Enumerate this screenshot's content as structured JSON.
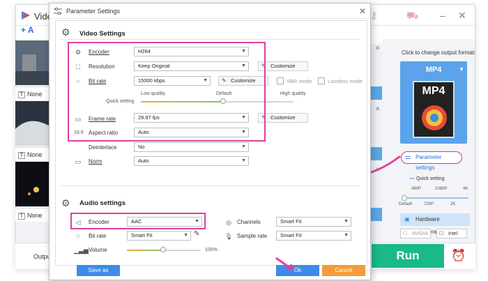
{
  "background_app": {
    "title": "Video",
    "add_label": "+ A",
    "thumb_rows": [
      {
        "label": "None"
      },
      {
        "label": "None"
      },
      {
        "label": "None"
      }
    ],
    "output_label": "Output f",
    "right_panel": {
      "format_title": "Click to change output format:",
      "format_name": "MP4",
      "format_box_text": "MP4",
      "parameter_button": "Parameter settings",
      "quick_setting": "Quick setting",
      "quality_top": [
        "480P",
        "1080P",
        "4K"
      ],
      "quality_bottom": [
        "Default",
        "720P",
        "2K"
      ],
      "hardware_button": "Hardware acceleration",
      "chips": [
        "NVIDIA",
        "Intel"
      ]
    },
    "run_label": "Run"
  },
  "dialog": {
    "title": "Parameter Settings",
    "video_section": {
      "title": "Video Settings",
      "encoder": {
        "label": "Encoder",
        "value": "H264"
      },
      "resolution": {
        "label": "Resolution",
        "value": "Keep Original",
        "custom_label": "Customize"
      },
      "bitrate": {
        "label": "Bit rate",
        "value": "15000 kbps",
        "custom_label": "Customize",
        "vbr_label": "VBR mode",
        "lossless_label": "Lossless mode"
      },
      "quality": {
        "quick_label": "Quick setting",
        "low": "Low quality",
        "default": "Default",
        "high": "High quality"
      },
      "framerate": {
        "label": "Frame rate",
        "value": "29.97 fps",
        "custom_label": "Customize"
      },
      "aspect": {
        "label": "Aspect ratio",
        "value": "Auto"
      },
      "deinterlace": {
        "label": "Deinterlace",
        "value": "No"
      },
      "norm": {
        "label": "Norm",
        "value": "Auto"
      }
    },
    "audio_section": {
      "title": "Audio settings",
      "encoder": {
        "label": "Encoder",
        "value": "AAC"
      },
      "bitrate": {
        "label": "Bit rate",
        "value": "Smart Fit"
      },
      "volume": {
        "label": "Volume",
        "value": "100%"
      },
      "channels": {
        "label": "Channels",
        "value": "Smart Fit"
      },
      "samplerate": {
        "label": "Sample rate",
        "value": "Smart Fit"
      }
    },
    "buttons": {
      "save_as": "Save as",
      "ok": "Ok",
      "cancel": "Cancel"
    }
  },
  "colors": {
    "highlight": "#e0409f",
    "accent_blue": "#3d8ce8",
    "run_green": "#19b98a",
    "cancel_orange": "#f39c3a"
  }
}
